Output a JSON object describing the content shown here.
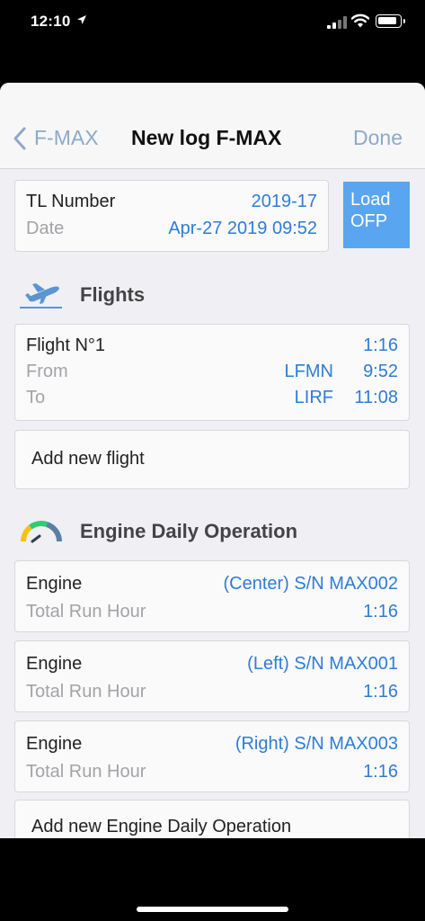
{
  "status": {
    "time": "12:10"
  },
  "nav": {
    "back_label": "F-MAX",
    "title": "New log F-MAX",
    "done_label": "Done"
  },
  "tl": {
    "number_label": "TL Number",
    "number_value": "2019-17",
    "date_label": "Date",
    "date_value": "Apr-27 2019 09:52"
  },
  "load_button": {
    "line1": "Load",
    "line2": "OFP"
  },
  "flights": {
    "section_title": "Flights",
    "items": [
      {
        "label": "Flight N°1",
        "duration": "1:16",
        "from_label": "From",
        "from_code": "LFMN",
        "from_time": "9:52",
        "to_label": "To",
        "to_code": "LIRF",
        "to_time": "11:08"
      }
    ],
    "add_label": "Add new flight"
  },
  "engines": {
    "section_title": "Engine Daily Operation",
    "items": [
      {
        "label": "Engine",
        "value": "(Center) S/N MAX002",
        "hour_label": "Total Run Hour",
        "hour_value": "1:16"
      },
      {
        "label": "Engine",
        "value": "(Left) S/N MAX001",
        "hour_label": "Total Run Hour",
        "hour_value": "1:16"
      },
      {
        "label": "Engine",
        "value": "(Right) S/N MAX003",
        "hour_label": "Total Run Hour",
        "hour_value": "1:16"
      }
    ],
    "add_label": "Add new Engine Daily Operation"
  },
  "colors": {
    "accent": "#2f7cd6",
    "button": "#5aa5ef",
    "nav_link": "#8ea9c9",
    "background": "#efeff4"
  }
}
